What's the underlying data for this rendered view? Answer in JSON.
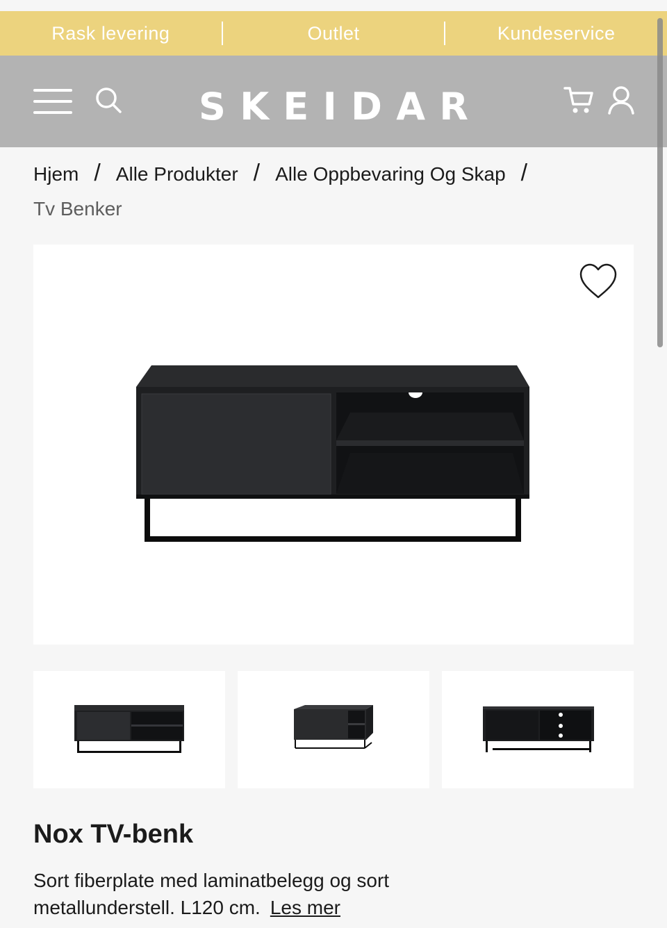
{
  "promo": {
    "items": [
      "Rask levering",
      "Outlet",
      "Kundeservice"
    ]
  },
  "header": {
    "logo_letters": [
      "S",
      "K",
      "E",
      "I",
      "D",
      "A",
      "R"
    ],
    "icons": {
      "menu": "hamburger-menu-icon",
      "search": "search-icon",
      "cart": "cart-icon",
      "user": "user-icon"
    }
  },
  "breadcrumb": {
    "items": [
      "Hjem",
      "Alle Produkter",
      "Alle Oppbevaring Og Skap"
    ],
    "separator": "/",
    "current": "Tv Benker"
  },
  "product": {
    "title": "Nox TV-benk",
    "description": "Sort fiberplate med laminatbelegg og sort metallunderstell. L120 cm.",
    "read_more": "Les mer",
    "favorite_icon": "heart-icon",
    "images": [
      "front-view",
      "angled-view",
      "front-view-open"
    ]
  },
  "colors": {
    "promo_bar": "#ecd37e",
    "header": "#b3b3b3",
    "background": "#f6f6f6",
    "text": "#1b1b1b"
  }
}
